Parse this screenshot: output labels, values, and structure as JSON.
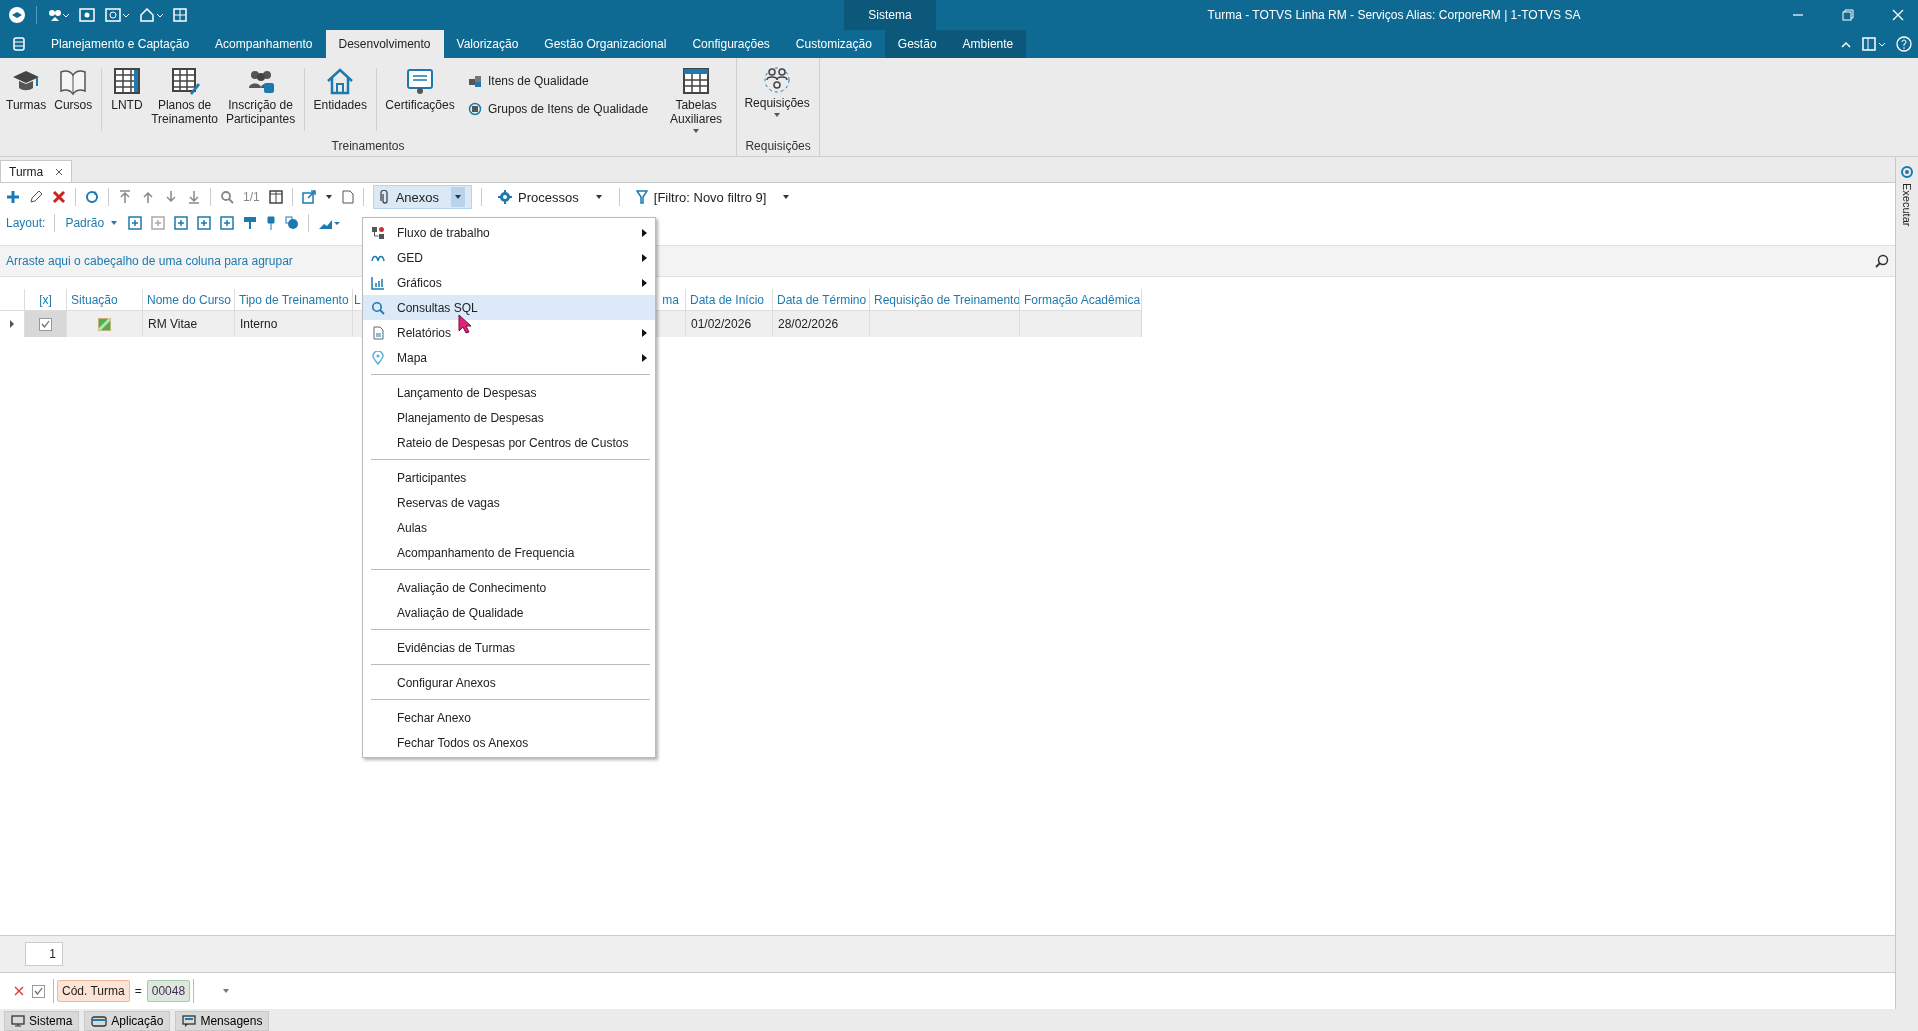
{
  "title_bar": {
    "app_group": "Sistema",
    "title": "Turma - TOTVS Linha RM - Serviços  Alias: CorporeRM | 1-TOTVS SA"
  },
  "menu_tabs": [
    {
      "label": "Planejamento e Captação",
      "selected": false
    },
    {
      "label": "Acompanhamento",
      "selected": false
    },
    {
      "label": "Desenvolvimento",
      "selected": true
    },
    {
      "label": "Valorização",
      "selected": false
    },
    {
      "label": "Gestão Organizacional",
      "selected": false
    },
    {
      "label": "Configurações",
      "selected": false
    },
    {
      "label": "Customização",
      "selected": false
    },
    {
      "label": "Gestão",
      "selected": false
    },
    {
      "label": "Ambiente",
      "selected": false
    }
  ],
  "ribbon": {
    "groups": [
      {
        "label": "Treinamentos",
        "items": [
          {
            "kind": "large",
            "label": "Turmas"
          },
          {
            "kind": "large",
            "label": "Cursos"
          },
          {
            "kind": "large",
            "label": "LNTD"
          },
          {
            "kind": "large",
            "label": "Planos de Treinamento"
          },
          {
            "kind": "large",
            "label": "Inscrição de Participantes"
          },
          {
            "kind": "large",
            "label": "Entidades"
          },
          {
            "kind": "large",
            "label": "Certificações"
          },
          {
            "kind": "small",
            "label": "Itens de Qualidade"
          },
          {
            "kind": "small",
            "label": "Grupos de Itens de Qualidade"
          },
          {
            "kind": "dropdown",
            "label": "Tabelas Auxiliares"
          }
        ]
      },
      {
        "label": "Requisições",
        "items": [
          {
            "kind": "dropdown",
            "label": "Requisições"
          }
        ]
      }
    ]
  },
  "doc_tabs": [
    {
      "label": "Turma",
      "selected": true
    }
  ],
  "toolbar": {
    "page": "1/1",
    "buttons": [
      {
        "label": "Anexos",
        "expanded": true
      },
      {
        "label": "Processos",
        "expanded": false
      },
      {
        "label": "[Filtro: Novo filtro 9]",
        "expanded": false
      }
    ],
    "layout_label": "Layout:",
    "layout_value": "Padrão"
  },
  "group_panel": "Arraste aqui o cabeçalho de uma coluna para agrupar",
  "table": {
    "columns": [
      "[x]",
      "Situação",
      "Nome do Curso",
      "Tipo de Treinamento",
      "L",
      "ma",
      "Data de Início",
      "Data de Término",
      "Requisição de Treinamento",
      "Formação Acadêmica"
    ],
    "rows": [
      {
        "expanded": false,
        "checked": true,
        "cells": [
          "",
          "",
          "RM Vitae",
          "Interno",
          "",
          "",
          "01/02/2026",
          "28/02/2026",
          "",
          ""
        ]
      }
    ]
  },
  "context_menu": [
    {
      "kind": "submenu",
      "label": "Fluxo de trabalho",
      "selected": false
    },
    {
      "kind": "submenu",
      "label": "GED",
      "selected": false
    },
    {
      "kind": "submenu",
      "label": "Gráficos",
      "selected": false
    },
    {
      "kind": "item",
      "label": "Consultas SQL",
      "selected": true
    },
    {
      "kind": "submenu",
      "label": "Relatórios",
      "selected": false
    },
    {
      "kind": "submenu",
      "label": "Mapa",
      "selected": false
    },
    {
      "kind": "separator"
    },
    {
      "kind": "item",
      "label": "Lançamento de Despesas",
      "selected": false
    },
    {
      "kind": "item",
      "label": "Planejamento de Despesas",
      "selected": false
    },
    {
      "kind": "item",
      "label": "Rateio de Despesas por Centros de Custos",
      "selected": false
    },
    {
      "kind": "separator"
    },
    {
      "kind": "item",
      "label": "Participantes",
      "selected": false
    },
    {
      "kind": "item",
      "label": "Reservas de vagas",
      "selected": false
    },
    {
      "kind": "item",
      "label": "Aulas",
      "selected": false
    },
    {
      "kind": "item",
      "label": "Acompanhamento de Frequencia",
      "selected": false
    },
    {
      "kind": "separator"
    },
    {
      "kind": "item",
      "label": "Avaliação de Conhecimento",
      "selected": false
    },
    {
      "kind": "item",
      "label": "Avaliação de Qualidade",
      "selected": false
    },
    {
      "kind": "separator"
    },
    {
      "kind": "item",
      "label": "Evidências de Turmas",
      "selected": false
    },
    {
      "kind": "separator"
    },
    {
      "kind": "item",
      "label": "Configurar Anexos",
      "selected": false
    },
    {
      "kind": "separator"
    },
    {
      "kind": "item",
      "label": "Fechar Anexo",
      "selected": false
    },
    {
      "kind": "item",
      "label": "Fechar Todos os Anexos",
      "selected": false
    }
  ],
  "footer": {
    "row_count": "1"
  },
  "filter": {
    "checked": true,
    "field": "Cód. Turma",
    "operator": "=",
    "value": "00048"
  },
  "side_panel": {
    "label": "Executar"
  },
  "status_tabs": [
    "Sistema",
    "Aplicação",
    "Mensagens"
  ]
}
